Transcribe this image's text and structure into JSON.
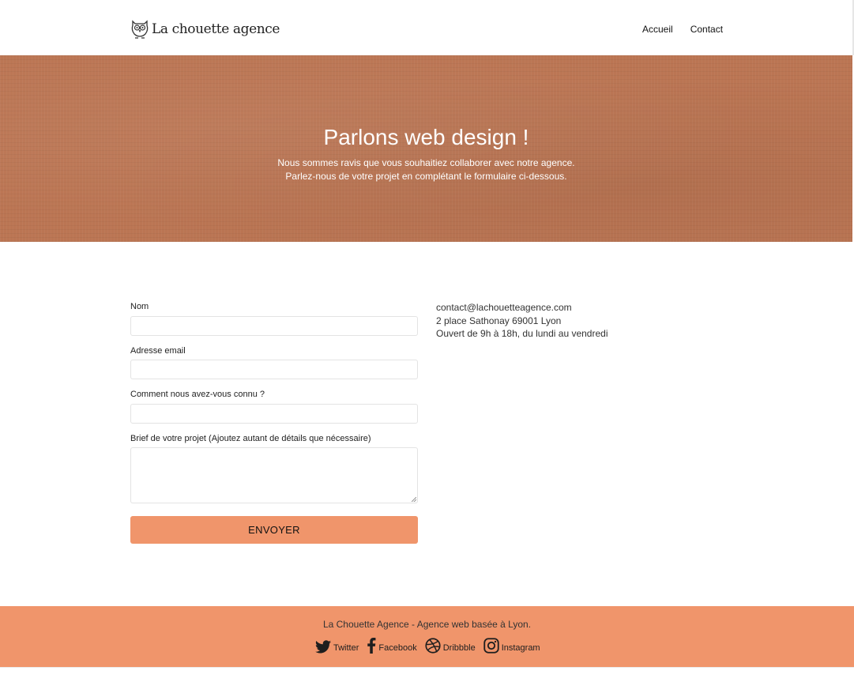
{
  "header": {
    "brand": "La chouette agence",
    "nav": {
      "home": "Accueil",
      "contact": "Contact"
    }
  },
  "hero": {
    "title": "Parlons web design !",
    "line1": "Nous sommes ravis que vous souhaitiez collaborer avec notre agence.",
    "line2": "Parlez-nous de votre projet en complétant le formulaire ci-dessous."
  },
  "form": {
    "name_label": "Nom",
    "name_value": "",
    "email_label": "Adresse email",
    "email_value": "",
    "source_label": "Comment nous avez-vous connu ?",
    "source_value": "",
    "brief_label": "Brief de votre projet (Ajoutez autant de détails que nécessaire)",
    "brief_value": "",
    "submit_label": "ENVOYER"
  },
  "info": {
    "email": "contact@lachouetteagence.com",
    "address": "2 place Sathonay 69001 Lyon",
    "hours": "Ouvert de 9h à 18h, du lundi au vendredi"
  },
  "footer": {
    "tagline": "La Chouette Agence - Agence web basée à Lyon.",
    "socials": [
      {
        "label": "Twitter",
        "icon": "twitter-icon"
      },
      {
        "label": "Facebook",
        "icon": "facebook-icon"
      },
      {
        "label": "Dribbble",
        "icon": "dribbble-icon"
      },
      {
        "label": "Instagram",
        "icon": "instagram-icon"
      }
    ]
  },
  "colors": {
    "hero_bg": "#bb7553",
    "accent": "#f0956b"
  }
}
